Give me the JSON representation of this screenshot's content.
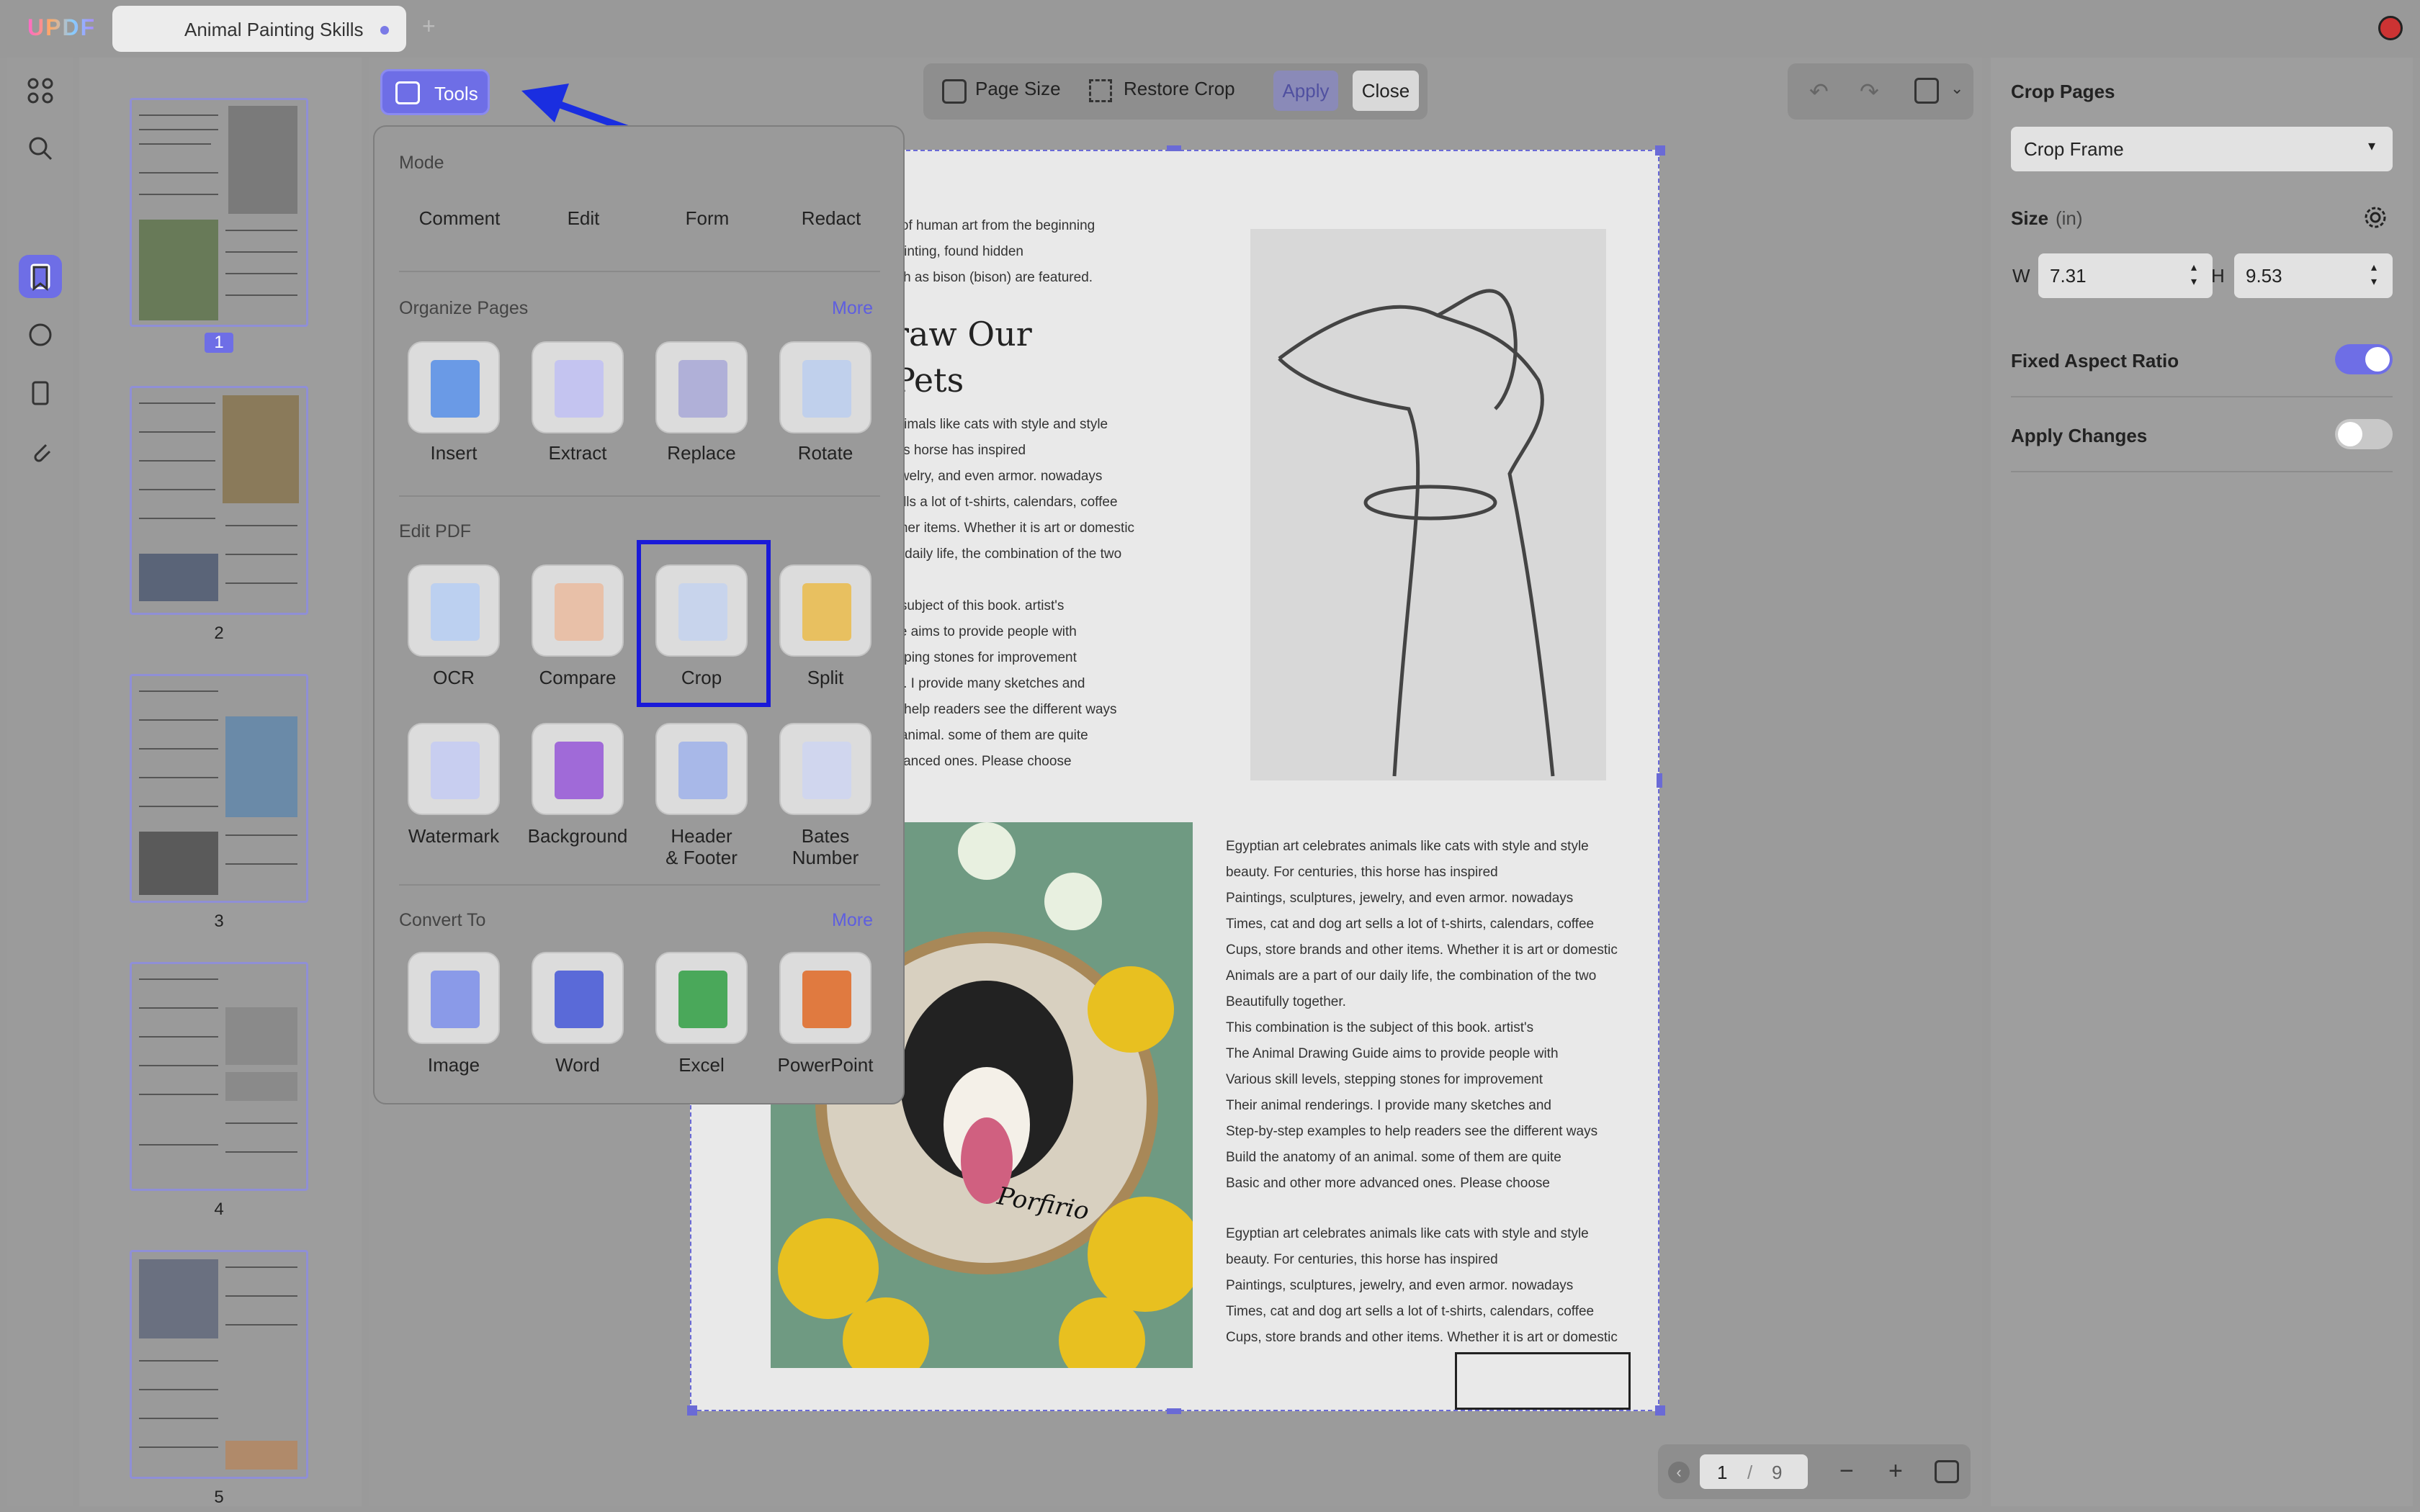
{
  "app": {
    "logo": "UPDF",
    "tab_title": "Animal Painting Skills",
    "new_tab": "+"
  },
  "toolbar": {
    "tools_label": "Tools",
    "page_size": "Page Size",
    "restore_crop": "Restore Crop",
    "apply": "Apply",
    "close": "Close"
  },
  "menu": {
    "mode_title": "Mode",
    "modes": [
      "Comment",
      "Edit",
      "Form",
      "Redact"
    ],
    "organize_title": "Organize Pages",
    "organize_more": "More",
    "organize": [
      "Insert",
      "Extract",
      "Replace",
      "Rotate"
    ],
    "edit_title": "Edit PDF",
    "edit_row1": [
      "OCR",
      "Compare",
      "Crop",
      "Split"
    ],
    "edit_row2": [
      "Watermark",
      "Background",
      "Header\n& Footer",
      "Bates\nNumber"
    ],
    "convert_title": "Convert To",
    "convert_more": "More",
    "convert": [
      "Image",
      "Word",
      "Excel",
      "PowerPoint"
    ]
  },
  "thumbnails": {
    "pages": [
      "1",
      "2",
      "3",
      "4",
      "5"
    ]
  },
  "page": {
    "left_lines": [
      "rt of human art from the beginning",
      "painting, found hidden",
      "uch as bison (bison) are featured."
    ],
    "heading": [
      "raw Our",
      "Pets"
    ],
    "left_para": [
      "animals like cats with style and style",
      "this horse has inspired",
      "jewelry, and even armor. nowadays",
      "sells a lot of t-shirts, calendars, coffee",
      "other items. Whether it is art or domestic",
      "ur daily life, the combination of the two"
    ],
    "left_para2": [
      "e subject of this book. artist's",
      "ide aims to provide people with",
      "epping stones for improvement",
      "gs. I provide many sketches and",
      "to help readers see the different ways",
      "n animal. some of them are quite",
      "dvanced ones. Please choose"
    ],
    "right_para": [
      "Egyptian art celebrates animals like cats with style and style",
      "beauty. For centuries, this horse has inspired",
      "Paintings, sculptures, jewelry, and even armor. nowadays",
      "Times, cat and dog art sells a lot of t-shirts, calendars, coffee",
      "Cups, store brands and other items. Whether it is art or domestic",
      "Animals are a part of our daily life, the combination of the two",
      "Beautifully together.",
      "This combination is the subject of this book. artist's",
      "The Animal Drawing Guide aims to provide people with",
      "Various skill levels, stepping stones for improvement",
      "Their animal renderings. I provide many sketches and",
      "Step-by-step examples to help readers see the different ways",
      "Build the anatomy of an animal. some of them are quite",
      "Basic and other more advanced ones. Please choose"
    ],
    "right_para2": [
      "Egyptian art celebrates animals like cats with style and style",
      "beauty. For centuries, this horse has inspired",
      "Paintings, sculptures, jewelry, and even armor. nowadays",
      "Times, cat and dog art sells a lot of t-shirts, calendars, coffee",
      "Cups, store brands and other items. Whether it is art or domestic"
    ],
    "signature": "Porfirio"
  },
  "zoom": {
    "current_page": "1",
    "separator": "/",
    "total_pages": "9"
  },
  "crop_panel": {
    "title": "Crop Pages",
    "frame_select": "Crop Frame",
    "size_label": "Size",
    "size_unit": "(in)",
    "w_label": "W",
    "w_value": "7.31",
    "h_label": "H",
    "h_value": "9.53",
    "fixed_aspect": "Fixed Aspect Ratio",
    "fixed_aspect_on": true,
    "apply_changes": "Apply Changes",
    "apply_changes_on": false
  },
  "colors": {
    "accent": "#6e6ee6",
    "highlight": "#1a1ad8",
    "arrow": "#1a2ee0"
  }
}
